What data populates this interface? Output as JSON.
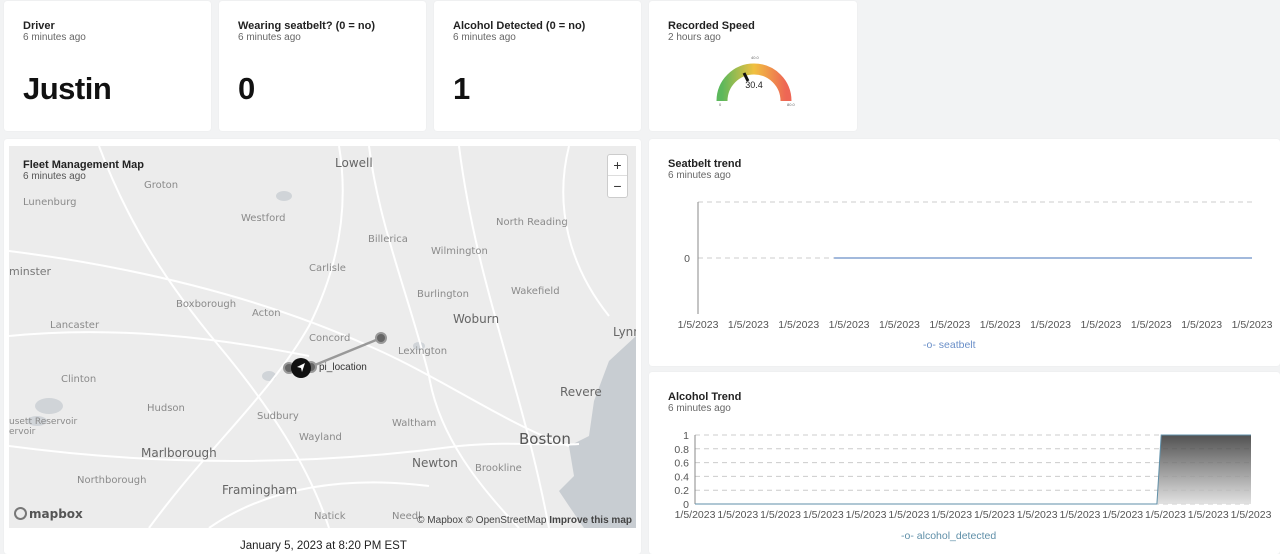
{
  "tiles": {
    "driver": {
      "title": "Driver",
      "updated": "6 minutes ago",
      "value": "Justin"
    },
    "seatbelt": {
      "title": "Wearing seatbelt? (0 = no)",
      "updated": "6 minutes ago",
      "value": "0"
    },
    "alcohol": {
      "title": "Alcohol Detected (0 = no)",
      "updated": "6 minutes ago",
      "value": "1"
    },
    "speed": {
      "title": "Recorded Speed",
      "updated": "2 hours ago",
      "value": "30.4",
      "min_label": "0",
      "mid_label": "40.0",
      "max_label": "80.0"
    }
  },
  "map": {
    "title": "Fleet Management Map",
    "updated": "6 minutes ago",
    "zoom_in": "+",
    "zoom_out": "−",
    "marker_label": "pi_location",
    "logo": "mapbox",
    "attribution": "© Mapbox © OpenStreetMap",
    "improve": "Improve this map",
    "timestamp": "January 5, 2023 at 8:20 PM EST",
    "places": [
      "Lowell",
      "Groton",
      "Lunenburg",
      "Westford",
      "North Reading",
      "Billerica",
      "Wilmington",
      "minster",
      "Carlisle",
      "Burlington",
      "Wakefield",
      "Boxborough",
      "Acton",
      "Woburn",
      "Lancaster",
      "Concord",
      "Lynn",
      "Lexington",
      "Clinton",
      "Revere",
      "Hudson",
      "Sudbury",
      "usett Reservoir",
      "ervoir",
      "Waltham",
      "Wayland",
      "Boston",
      "Marlborough",
      "Newton",
      "Northborough",
      "Brookline",
      "Framingham",
      "Natick",
      "Needl"
    ]
  },
  "seatbelt_chart": {
    "title": "Seatbelt trend",
    "updated": "6 minutes ago",
    "legend": "seatbelt",
    "color": "#6a8fc8"
  },
  "alcohol_chart": {
    "title": "Alcohol Trend",
    "updated": "6 minutes ago",
    "legend": "alcohol_detected",
    "color": "#5f8fa8"
  },
  "chart_data": [
    {
      "type": "line",
      "x": [
        "1/5/2023",
        "1/5/2023",
        "1/5/2023",
        "1/5/2023",
        "1/5/2023",
        "1/5/2023",
        "1/5/2023",
        "1/5/2023",
        "1/5/2023",
        "1/5/2023",
        "1/5/2023",
        "1/5/2023"
      ],
      "yticks": [
        "0"
      ],
      "series": [
        {
          "name": "seatbelt",
          "values": [
            null,
            null,
            null,
            0,
            0,
            0,
            0,
            0,
            0,
            0,
            0,
            0
          ]
        }
      ],
      "grid": true,
      "legend": "bottom"
    },
    {
      "type": "area",
      "x": [
        "1/5/2023",
        "1/5/2023",
        "1/5/2023",
        "1/5/2023",
        "1/5/2023",
        "1/5/2023",
        "1/5/2023",
        "1/5/2023",
        "1/5/2023",
        "1/5/2023",
        "1/5/2023",
        "1/5/2023",
        "1/5/2023",
        "1/5/2023"
      ],
      "yticks": [
        "0",
        "0.2",
        "0.4",
        "0.6",
        "0.8",
        "1"
      ],
      "ylim": [
        0,
        1
      ],
      "series": [
        {
          "name": "alcohol_detected",
          "values": [
            0,
            0,
            0,
            0,
            0,
            0,
            0,
            0,
            0,
            0,
            0,
            1,
            1,
            1
          ]
        }
      ],
      "grid": true,
      "legend": "bottom"
    }
  ]
}
